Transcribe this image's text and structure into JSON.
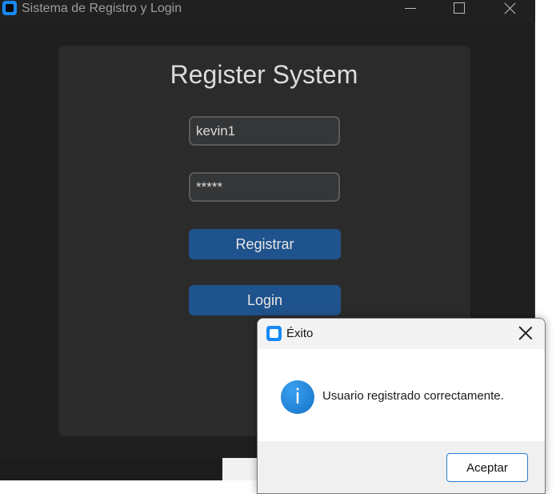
{
  "window": {
    "title": "Sistema de Registro y Login"
  },
  "form": {
    "heading": "Register System",
    "username_value": "kevin1",
    "password_value": "*****",
    "register_label": "Registrar",
    "login_label": "Login"
  },
  "dialog": {
    "title": "Éxito",
    "message": "Usuario registrado correctamente.",
    "ok_label": "Aceptar",
    "icon_glyph": "i"
  },
  "colors": {
    "accent": "#1f538d",
    "app_icon": "#1689f5",
    "window_bg": "#1f1f1f",
    "card_bg": "#2b2b2b"
  },
  "icons": [
    "app-icon",
    "minimize-icon",
    "maximize-icon",
    "close-icon",
    "info-icon"
  ]
}
